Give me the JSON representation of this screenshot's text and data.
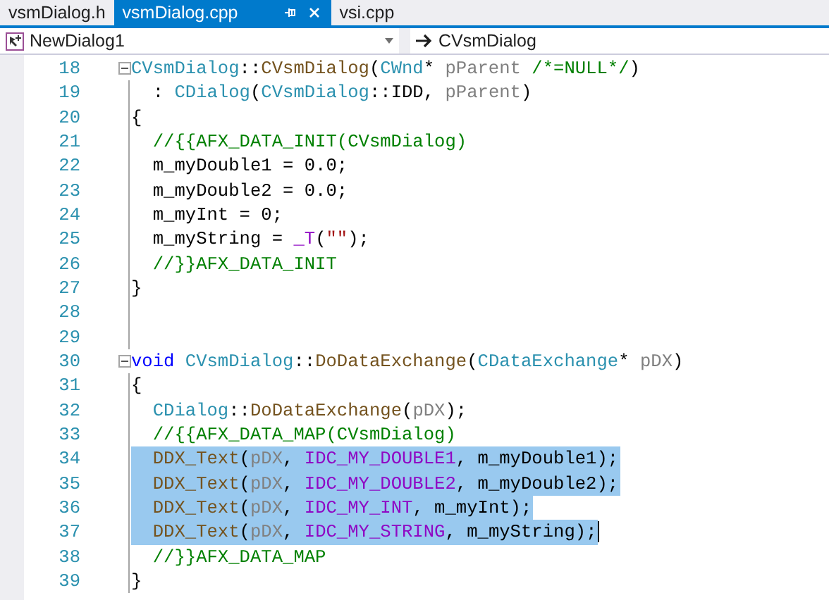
{
  "tabs": [
    {
      "label": "vsmDialog.h",
      "selected": false
    },
    {
      "label": "vsmDialog.cpp",
      "selected": true
    },
    {
      "label": "vsi.cpp",
      "selected": false
    }
  ],
  "navigation": {
    "scope": "NewDialog1",
    "member": "CVsmDialog"
  },
  "code_lines": [
    {
      "number": "18",
      "fold": true,
      "selected": false,
      "cursor": false,
      "tokens": [
        {
          "kind": "type",
          "text": "CVsmDialog"
        },
        {
          "kind": "plain",
          "text": "::"
        },
        {
          "kind": "func",
          "text": "CVsmDialog"
        },
        {
          "kind": "plain",
          "text": "("
        },
        {
          "kind": "type",
          "text": "CWnd"
        },
        {
          "kind": "plain",
          "text": "* "
        },
        {
          "kind": "param",
          "text": "pParent"
        },
        {
          "kind": "comment",
          "text": " /*=NULL*/"
        },
        {
          "kind": "plain",
          "text": ")"
        }
      ]
    },
    {
      "number": "19",
      "fold": false,
      "selected": false,
      "cursor": false,
      "tokens": [
        {
          "kind": "plain",
          "text": "  : "
        },
        {
          "kind": "type",
          "text": "CDialog"
        },
        {
          "kind": "plain",
          "text": "("
        },
        {
          "kind": "type",
          "text": "CVsmDialog"
        },
        {
          "kind": "plain",
          "text": "::IDD, "
        },
        {
          "kind": "param",
          "text": "pParent"
        },
        {
          "kind": "plain",
          "text": ")"
        }
      ]
    },
    {
      "number": "20",
      "fold": false,
      "selected": false,
      "cursor": false,
      "tokens": [
        {
          "kind": "plain",
          "text": "{"
        }
      ]
    },
    {
      "number": "21",
      "fold": false,
      "selected": false,
      "cursor": false,
      "tokens": [
        {
          "kind": "comment",
          "text": "  //{{AFX_DATA_INIT(CVsmDialog)"
        }
      ]
    },
    {
      "number": "22",
      "fold": false,
      "selected": false,
      "cursor": false,
      "tokens": [
        {
          "kind": "plain",
          "text": "  m_myDouble1 = 0.0;"
        }
      ]
    },
    {
      "number": "23",
      "fold": false,
      "selected": false,
      "cursor": false,
      "tokens": [
        {
          "kind": "plain",
          "text": "  m_myDouble2 = 0.0;"
        }
      ]
    },
    {
      "number": "24",
      "fold": false,
      "selected": false,
      "cursor": false,
      "tokens": [
        {
          "kind": "plain",
          "text": "  m_myInt = 0;"
        }
      ]
    },
    {
      "number": "25",
      "fold": false,
      "selected": false,
      "cursor": false,
      "tokens": [
        {
          "kind": "plain",
          "text": "  m_myString = "
        },
        {
          "kind": "macro",
          "text": "_T"
        },
        {
          "kind": "plain",
          "text": "("
        },
        {
          "kind": "string",
          "text": "\"\""
        },
        {
          "kind": "plain",
          "text": ");"
        }
      ]
    },
    {
      "number": "26",
      "fold": false,
      "selected": false,
      "cursor": false,
      "tokens": [
        {
          "kind": "comment",
          "text": "  //}}AFX_DATA_INIT"
        }
      ]
    },
    {
      "number": "27",
      "fold": false,
      "selected": false,
      "cursor": false,
      "tokens": [
        {
          "kind": "plain",
          "text": "}"
        }
      ]
    },
    {
      "number": "28",
      "fold": false,
      "selected": false,
      "cursor": false
    },
    {
      "number": "29",
      "fold": false,
      "selected": false,
      "cursor": false
    },
    {
      "number": "30",
      "fold": true,
      "selected": false,
      "cursor": false,
      "tokens": [
        {
          "kind": "keyword",
          "text": "void"
        },
        {
          "kind": "type",
          "text": " CVsmDialog"
        },
        {
          "kind": "plain",
          "text": "::"
        },
        {
          "kind": "func",
          "text": "DoDataExchange"
        },
        {
          "kind": "plain",
          "text": "("
        },
        {
          "kind": "type",
          "text": "CDataExchange"
        },
        {
          "kind": "plain",
          "text": "* "
        },
        {
          "kind": "param",
          "text": "pDX"
        },
        {
          "kind": "plain",
          "text": ")"
        }
      ]
    },
    {
      "number": "31",
      "fold": false,
      "selected": false,
      "cursor": false,
      "tokens": [
        {
          "kind": "plain",
          "text": "{"
        }
      ]
    },
    {
      "number": "32",
      "fold": false,
      "selected": false,
      "cursor": false,
      "tokens": [
        {
          "kind": "type",
          "text": "  CDialog"
        },
        {
          "kind": "plain",
          "text": "::"
        },
        {
          "kind": "func",
          "text": "DoDataExchange"
        },
        {
          "kind": "plain",
          "text": "("
        },
        {
          "kind": "param",
          "text": "pDX"
        },
        {
          "kind": "plain",
          "text": ");"
        }
      ]
    },
    {
      "number": "33",
      "fold": false,
      "selected": false,
      "cursor": false,
      "tokens": [
        {
          "kind": "comment",
          "text": "  //{{AFX_DATA_MAP(CVsmDialog)"
        }
      ]
    },
    {
      "number": "34",
      "fold": false,
      "selected": true,
      "cursor": false,
      "tokens": [
        {
          "kind": "func",
          "text": "  DDX_Text"
        },
        {
          "kind": "plain",
          "text": "("
        },
        {
          "kind": "param",
          "text": "pDX"
        },
        {
          "kind": "plain",
          "text": ", "
        },
        {
          "kind": "macro",
          "text": "IDC_MY_DOUBLE1"
        },
        {
          "kind": "plain",
          "text": ", m_myDouble1);"
        }
      ]
    },
    {
      "number": "35",
      "fold": false,
      "selected": true,
      "cursor": false,
      "tokens": [
        {
          "kind": "func",
          "text": "  DDX_Text"
        },
        {
          "kind": "plain",
          "text": "("
        },
        {
          "kind": "param",
          "text": "pDX"
        },
        {
          "kind": "plain",
          "text": ", "
        },
        {
          "kind": "macro",
          "text": "IDC_MY_DOUBLE2"
        },
        {
          "kind": "plain",
          "text": ", m_myDouble2);"
        }
      ]
    },
    {
      "number": "36",
      "fold": false,
      "selected": true,
      "cursor": false,
      "tokens": [
        {
          "kind": "func",
          "text": "  DDX_Text"
        },
        {
          "kind": "plain",
          "text": "("
        },
        {
          "kind": "param",
          "text": "pDX"
        },
        {
          "kind": "plain",
          "text": ", "
        },
        {
          "kind": "macro",
          "text": "IDC_MY_INT"
        },
        {
          "kind": "plain",
          "text": ", m_myInt);"
        }
      ]
    },
    {
      "number": "37",
      "fold": false,
      "selected": true,
      "cursor": true,
      "tokens": [
        {
          "kind": "func",
          "text": "  DDX_Text"
        },
        {
          "kind": "plain",
          "text": "("
        },
        {
          "kind": "param",
          "text": "pDX"
        },
        {
          "kind": "plain",
          "text": ", "
        },
        {
          "kind": "macro",
          "text": "IDC_MY_STRING"
        },
        {
          "kind": "plain",
          "text": ", m_myString);"
        }
      ]
    },
    {
      "number": "38",
      "fold": false,
      "selected": false,
      "cursor": false,
      "tokens": [
        {
          "kind": "comment",
          "text": "  //}}AFX_DATA_MAP"
        }
      ]
    },
    {
      "number": "39",
      "fold": false,
      "selected": false,
      "cursor": false,
      "tokens": [
        {
          "kind": "plain",
          "text": "}"
        }
      ]
    }
  ]
}
